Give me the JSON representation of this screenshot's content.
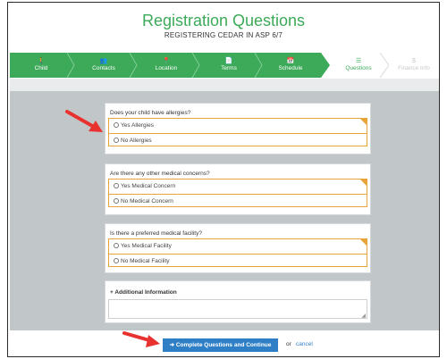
{
  "header": {
    "title": "Registration Questions",
    "subtitle": "REGISTERING CEDAR IN ASP 6/7"
  },
  "steps": [
    {
      "label": "Child",
      "icon": "child-icon",
      "glyph": "🚶",
      "status": "done"
    },
    {
      "label": "Contacts",
      "icon": "contacts-icon",
      "glyph": "👥",
      "status": "done"
    },
    {
      "label": "Location",
      "icon": "map-marker-icon",
      "glyph": "📍",
      "status": "done"
    },
    {
      "label": "Terms",
      "icon": "document-icon",
      "glyph": "📄",
      "status": "done"
    },
    {
      "label": "Schedule",
      "icon": "calendar-icon",
      "glyph": "📅",
      "status": "done"
    },
    {
      "label": "Questions",
      "icon": "list-icon",
      "glyph": "☰",
      "status": "active"
    },
    {
      "label": "Finance Info",
      "icon": "dollar-icon",
      "glyph": "$",
      "status": "pending"
    }
  ],
  "questions": [
    {
      "label": "Does your child have allergies?",
      "options": [
        "Yes Allergies",
        "No Allergies"
      ]
    },
    {
      "label": "Are there any other medical concerns?",
      "options": [
        "Yes Medical Concern",
        "No Medical Concern"
      ]
    },
    {
      "label": "Is there a preferred medical facility?",
      "options": [
        "Yes Medical Facility",
        "No Medical Facility"
      ]
    }
  ],
  "additional_info": {
    "label": "+ Additional Information",
    "value": ""
  },
  "footer": {
    "continue_label": "➜ Complete Questions and Continue",
    "or_text": "or",
    "cancel_label": "cancel"
  },
  "colors": {
    "brand_green": "#3caa59",
    "option_border": "#e8a33a",
    "primary_button": "#2f7fc6",
    "annotation_arrow": "#e8322f"
  }
}
